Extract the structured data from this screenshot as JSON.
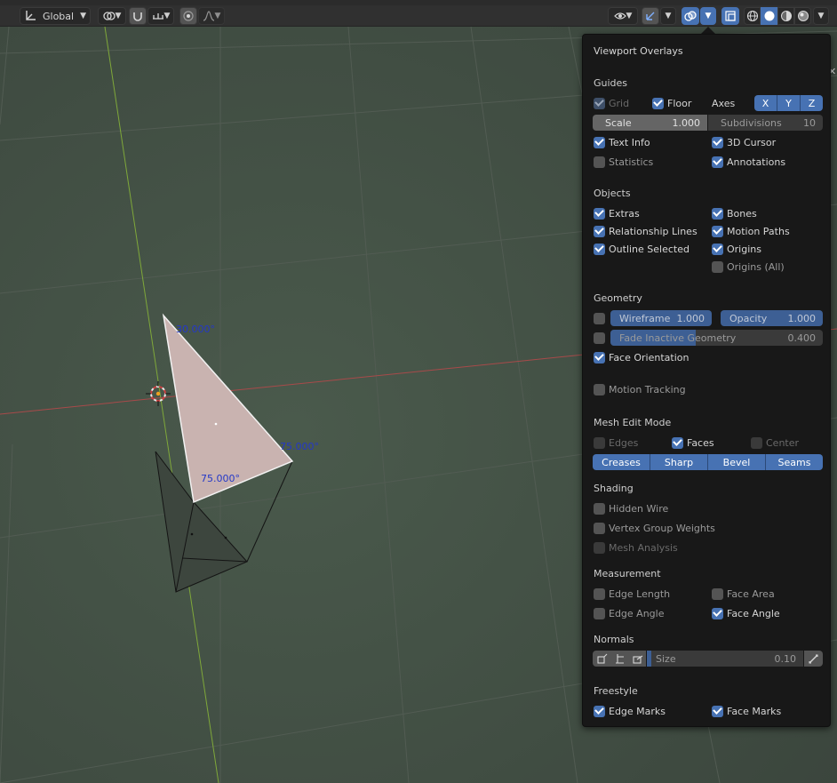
{
  "header": {
    "orientation": "Global"
  },
  "viewport": {
    "angle_labels": [
      "30.000°",
      "75.000°",
      "75.000°"
    ]
  },
  "overlays": {
    "title": "Viewport Overlays",
    "guides": {
      "section": "Guides",
      "grid": "Grid",
      "floor": "Floor",
      "axes_label": "Axes",
      "axes": [
        "X",
        "Y",
        "Z"
      ],
      "scale_label": "Scale",
      "scale_value": "1.000",
      "subdivisions_label": "Subdivisions",
      "subdivisions_value": "10",
      "text_info": "Text Info",
      "cursor_3d": "3D Cursor",
      "statistics": "Statistics",
      "annotations": "Annotations"
    },
    "objects": {
      "section": "Objects",
      "extras": "Extras",
      "bones": "Bones",
      "relationship_lines": "Relationship Lines",
      "motion_paths": "Motion Paths",
      "outline_selected": "Outline Selected",
      "origins": "Origins",
      "origins_all": "Origins (All)"
    },
    "geometry": {
      "section": "Geometry",
      "wireframe_label": "Wireframe",
      "wireframe_value": "1.000",
      "opacity_label": "Opacity",
      "opacity_value": "1.000",
      "fade_label": "Fade Inactive Geometry",
      "fade_value": "0.400",
      "face_orientation": "Face Orientation"
    },
    "motion_tracking": "Motion Tracking",
    "mesh_edit": {
      "section": "Mesh Edit Mode",
      "edges": "Edges",
      "faces": "Faces",
      "center": "Center",
      "buttons": [
        "Creases",
        "Sharp",
        "Bevel",
        "Seams"
      ]
    },
    "shading": {
      "section": "Shading",
      "hidden_wire": "Hidden Wire",
      "vertex_group_weights": "Vertex Group Weights",
      "mesh_analysis": "Mesh Analysis"
    },
    "measurement": {
      "section": "Measurement",
      "edge_length": "Edge Length",
      "face_area": "Face Area",
      "edge_angle": "Edge Angle",
      "face_angle": "Face Angle"
    },
    "normals": {
      "section": "Normals",
      "size_label": "Size",
      "size_value": "0.10"
    },
    "freestyle": {
      "section": "Freestyle",
      "edge_marks": "Edge Marks",
      "face_marks": "Face Marks"
    }
  }
}
